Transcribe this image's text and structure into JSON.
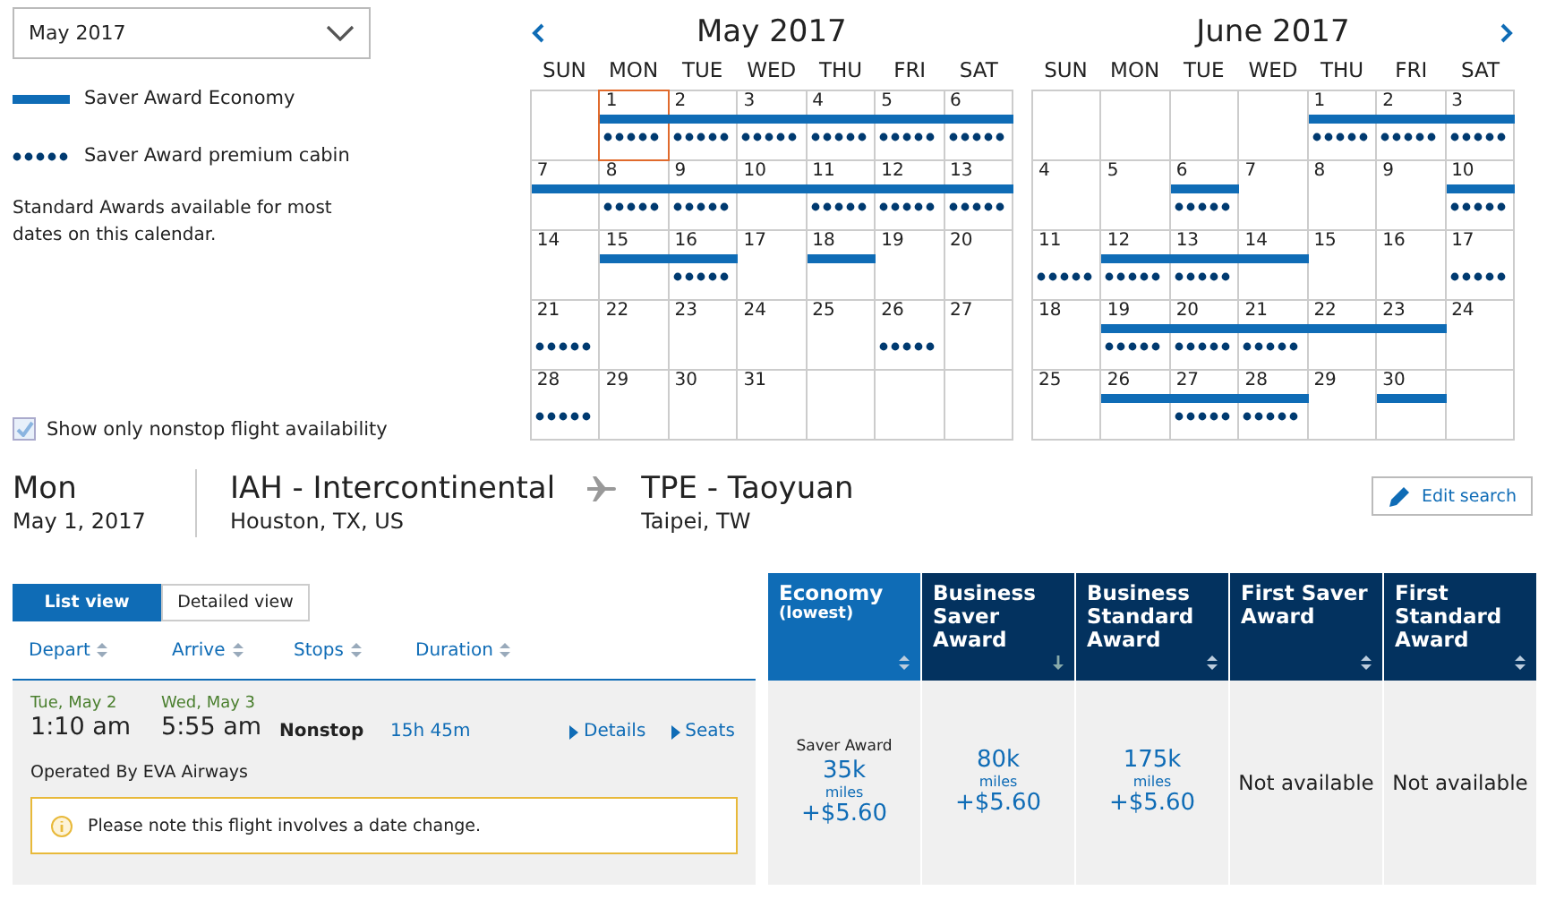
{
  "month_select": {
    "value": "May 2017"
  },
  "legend": [
    {
      "kind": "bar",
      "label": "Saver Award Economy"
    },
    {
      "kind": "dots",
      "label": "Saver Award premium cabin"
    }
  ],
  "note": "Standard Awards available for most dates on this calendar.",
  "nonstop": {
    "label": "Show only nonstop flight availability",
    "checked": true
  },
  "calendars": [
    {
      "title": "May 2017",
      "weekdays": [
        "SUN",
        "MON",
        "TUE",
        "WED",
        "THU",
        "FRI",
        "SAT"
      ],
      "weeks": [
        [
          {
            "kind": "blank"
          },
          {
            "day": "1",
            "economy": true,
            "premium": true,
            "selected": true
          },
          {
            "day": "2",
            "economy": true,
            "premium": true,
            "selected": false
          },
          {
            "day": "3",
            "economy": true,
            "premium": true,
            "selected": false
          },
          {
            "day": "4",
            "economy": true,
            "premium": true,
            "selected": false
          },
          {
            "day": "5",
            "economy": true,
            "premium": true,
            "selected": false
          },
          {
            "day": "6",
            "economy": true,
            "premium": true,
            "selected": false
          }
        ],
        [
          {
            "day": "7",
            "economy": true,
            "premium": false,
            "selected": false
          },
          {
            "day": "8",
            "economy": true,
            "premium": true,
            "selected": false
          },
          {
            "day": "9",
            "economy": true,
            "premium": true,
            "selected": false
          },
          {
            "day": "10",
            "economy": true,
            "premium": false,
            "selected": false
          },
          {
            "day": "11",
            "economy": true,
            "premium": true,
            "selected": false
          },
          {
            "day": "12",
            "economy": true,
            "premium": true,
            "selected": false
          },
          {
            "day": "13",
            "economy": true,
            "premium": true,
            "selected": false
          }
        ],
        [
          {
            "day": "14",
            "economy": false,
            "premium": false,
            "selected": false
          },
          {
            "day": "15",
            "economy": true,
            "premium": false,
            "selected": false
          },
          {
            "day": "16",
            "economy": true,
            "premium": true,
            "selected": false
          },
          {
            "day": "17",
            "economy": false,
            "premium": false,
            "selected": false
          },
          {
            "day": "18",
            "economy": true,
            "premium": false,
            "selected": false
          },
          {
            "day": "19",
            "economy": false,
            "premium": false,
            "selected": false
          },
          {
            "day": "20",
            "economy": false,
            "premium": false,
            "selected": false
          }
        ],
        [
          {
            "day": "21",
            "economy": false,
            "premium": true,
            "selected": false
          },
          {
            "day": "22",
            "economy": false,
            "premium": false,
            "selected": false
          },
          {
            "day": "23",
            "economy": false,
            "premium": false,
            "selected": false
          },
          {
            "day": "24",
            "economy": false,
            "premium": false,
            "selected": false
          },
          {
            "day": "25",
            "economy": false,
            "premium": false,
            "selected": false
          },
          {
            "day": "26",
            "economy": false,
            "premium": true,
            "selected": false
          },
          {
            "day": "27",
            "economy": false,
            "premium": false,
            "selected": false
          }
        ],
        [
          {
            "day": "28",
            "economy": false,
            "premium": true,
            "selected": false
          },
          {
            "day": "29",
            "economy": false,
            "premium": false,
            "selected": false
          },
          {
            "day": "30",
            "economy": false,
            "premium": false,
            "selected": false
          },
          {
            "day": "31",
            "economy": false,
            "premium": false,
            "selected": false
          },
          {
            "kind": "blank"
          },
          {
            "kind": "blank"
          },
          {
            "kind": "blank"
          }
        ]
      ]
    },
    {
      "title": "June 2017",
      "weekdays": [
        "SUN",
        "MON",
        "TUE",
        "WED",
        "THU",
        "FRI",
        "SAT"
      ],
      "weeks": [
        [
          {
            "kind": "blank"
          },
          {
            "kind": "blank"
          },
          {
            "kind": "blank"
          },
          {
            "kind": "blank"
          },
          {
            "day": "1",
            "economy": true,
            "premium": true,
            "selected": false
          },
          {
            "day": "2",
            "economy": true,
            "premium": true,
            "selected": false
          },
          {
            "day": "3",
            "economy": true,
            "premium": true,
            "selected": false
          }
        ],
        [
          {
            "day": "4",
            "economy": false,
            "premium": false,
            "selected": false
          },
          {
            "day": "5",
            "economy": false,
            "premium": false,
            "selected": false
          },
          {
            "day": "6",
            "economy": true,
            "premium": true,
            "selected": false
          },
          {
            "day": "7",
            "economy": false,
            "premium": false,
            "selected": false
          },
          {
            "day": "8",
            "economy": false,
            "premium": false,
            "selected": false
          },
          {
            "day": "9",
            "economy": false,
            "premium": false,
            "selected": false
          },
          {
            "day": "10",
            "economy": true,
            "premium": true,
            "selected": false
          }
        ],
        [
          {
            "day": "11",
            "economy": false,
            "premium": true,
            "selected": false
          },
          {
            "day": "12",
            "economy": true,
            "premium": true,
            "selected": false
          },
          {
            "day": "13",
            "economy": true,
            "premium": true,
            "selected": false
          },
          {
            "day": "14",
            "economy": true,
            "premium": false,
            "selected": false
          },
          {
            "day": "15",
            "economy": false,
            "premium": false,
            "selected": false
          },
          {
            "day": "16",
            "economy": false,
            "premium": false,
            "selected": false
          },
          {
            "day": "17",
            "economy": false,
            "premium": true,
            "selected": false
          }
        ],
        [
          {
            "day": "18",
            "economy": false,
            "premium": false,
            "selected": false
          },
          {
            "day": "19",
            "economy": true,
            "premium": true,
            "selected": false
          },
          {
            "day": "20",
            "economy": true,
            "premium": true,
            "selected": false
          },
          {
            "day": "21",
            "economy": true,
            "premium": true,
            "selected": false
          },
          {
            "day": "22",
            "economy": true,
            "premium": false,
            "selected": false
          },
          {
            "day": "23",
            "economy": true,
            "premium": false,
            "selected": false
          },
          {
            "day": "24",
            "economy": false,
            "premium": false,
            "selected": false
          }
        ],
        [
          {
            "day": "25",
            "economy": false,
            "premium": false,
            "selected": false
          },
          {
            "day": "26",
            "economy": true,
            "premium": false,
            "selected": false
          },
          {
            "day": "27",
            "economy": true,
            "premium": true,
            "selected": false
          },
          {
            "day": "28",
            "economy": true,
            "premium": true,
            "selected": false
          },
          {
            "day": "29",
            "economy": false,
            "premium": false,
            "selected": false
          },
          {
            "day": "30",
            "economy": true,
            "premium": false,
            "selected": false
          },
          {
            "kind": "blank"
          }
        ]
      ]
    }
  ],
  "route": {
    "weekday": "Mon",
    "date": "May 1, 2017",
    "origin": "IAH - Intercontinental",
    "origin_city": "Houston, TX, US",
    "destination": "TPE - Taoyuan",
    "destination_city": "Taipei, TW"
  },
  "edit_search": "Edit search",
  "view_tabs": [
    {
      "label": "List view",
      "selected": true
    },
    {
      "label": "Detailed view",
      "selected": false
    }
  ],
  "columns": [
    "Depart",
    "Arrive",
    "Stops",
    "Duration"
  ],
  "fare_columns": [
    {
      "title": "Economy",
      "subtitle": "(lowest)",
      "selected": true,
      "sorted": false
    },
    {
      "title": "Business Saver Award",
      "selected": false,
      "sorted": true
    },
    {
      "title": "Business Standard Award",
      "selected": false,
      "sorted": false
    },
    {
      "title": "First Saver Award",
      "selected": false,
      "sorted": false
    },
    {
      "title": "First Standard Award",
      "selected": false,
      "sorted": false
    }
  ],
  "flight": {
    "depart_date": "Tue, May 2",
    "depart_time": "1:10 am",
    "arrive_date": "Wed, May 3",
    "arrive_time": "5:55 am",
    "stops": "Nonstop",
    "duration": "15h 45m",
    "details": "Details",
    "seats": "Seats",
    "operator": "Operated By EVA Airways",
    "alert": "Please note this flight involves a date change.",
    "fares": [
      {
        "kind": "price",
        "note": "Saver Award",
        "miles": "35k",
        "unit": "miles",
        "fee": "+$5.60"
      },
      {
        "kind": "price",
        "miles": "80k",
        "unit": "miles",
        "fee": "+$5.60"
      },
      {
        "kind": "price",
        "miles": "175k",
        "unit": "miles",
        "fee": "+$5.60"
      },
      {
        "kind": "none",
        "text": "Not available"
      },
      {
        "kind": "none",
        "text": "Not available"
      }
    ]
  }
}
